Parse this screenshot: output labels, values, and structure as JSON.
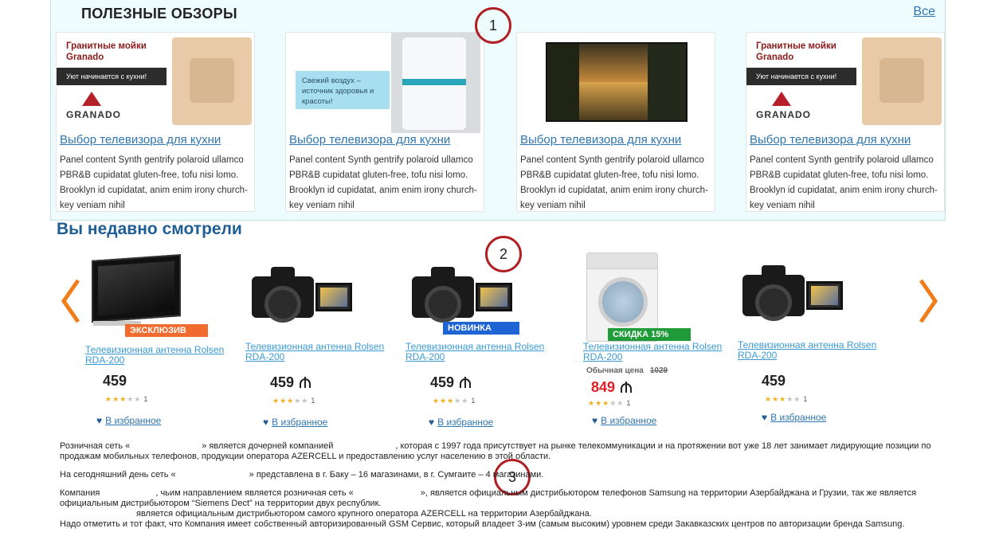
{
  "reviews": {
    "title": "ПОЛЕЗНЫЕ ОБЗОРЫ",
    "all_link": "Все",
    "cards": [
      {
        "title": "Выбор телевизора для кухни",
        "text": "Panel content Synth gentrify polaroid ullamco PBR&B cupidatat gluten-free, tofu nisi lomo. Brooklyn id cupidatat, anim enim irony church-key veniam nihil",
        "image": "granado",
        "brand_line1": "Гранитные мойки",
        "brand_line2": "Granado",
        "banner": "Уют начинается с кухни!",
        "logo": "GRANADO"
      },
      {
        "title": "Выбор телевизора для кухни",
        "text": "Panel content Synth gentrify polaroid ullamco PBR&B cupidatat gluten-free, tofu nisi lomo. Brooklyn id cupidatat, anim enim irony church-key veniam nihil",
        "image": "purifier",
        "promo": "Свежий воздух – источник здоровья и красоты!"
      },
      {
        "title": "Выбор телевизора для кухни",
        "text": "Panel content Synth gentrify polaroid ullamco PBR&B cupidatat gluten-free, tofu nisi lomo. Brooklyn id cupidatat, anim enim irony church-key veniam nihil",
        "image": "landscape-tv"
      },
      {
        "title": "Выбор телевизора для кухни",
        "text": "Panel content Synth gentrify polaroid ullamco PBR&B cupidatat gluten-free, tofu nisi lomo. Brooklyn id cupidatat, anim enim irony church-key veniam nihil",
        "image": "granado",
        "brand_line1": "Гранитные мойки",
        "brand_line2": "Granado",
        "banner": "Уют начинается с кухни!",
        "logo": "GRANADO"
      }
    ]
  },
  "recent": {
    "title": "Вы недавно смотрели",
    "prev_icon": "chevron-left-icon",
    "next_icon": "chevron-right-icon",
    "arrow_color": "#f07d1a",
    "fav_label": "В избранное",
    "products": [
      {
        "image": "tv",
        "badge": "ЭКСКЛЮЗИВ",
        "badge_color": "#f26b2e",
        "title": "Телевизионная антенна Rolsen RDA-200",
        "price": "459",
        "currency": false,
        "rating": 3,
        "reviews": "1"
      },
      {
        "image": "camera",
        "badge": "",
        "title": "Телевизионная антенна Rolsen RDA-200",
        "price": "459",
        "currency": true,
        "rating": 3,
        "reviews": "1"
      },
      {
        "image": "camera",
        "badge": "НОВИНКА",
        "badge_color": "#1f64d4",
        "title": "Телевизионная антенна Rolsen RDA-200",
        "price": "459",
        "currency": true,
        "rating": 3,
        "reviews": "1"
      },
      {
        "image": "washer",
        "badge": "СКИДКА 15%",
        "badge_color": "#1f9b3a",
        "title": "Телевизионная антенна Rolsen RDA-200",
        "old_price_label": "Обычная цена",
        "old_price": "1029",
        "price": "849",
        "currency": true,
        "rating": 3,
        "reviews": "1",
        "sale": true
      },
      {
        "image": "camera",
        "badge": "",
        "title": "Телевизионная антенна Rolsen RDA-200",
        "price": "459",
        "currency": false,
        "rating": 3,
        "reviews": "1"
      }
    ]
  },
  "annotations": [
    "1",
    "2",
    "3"
  ],
  "description": {
    "p1_a": "Розничная сеть «",
    "p1_b": "» является дочерней компанией",
    "p1_c": ", которая с 1997 года  присутствует на рынке телекоммуникации и  на протяжении вот уже 18 лет занимает лидирующие позиции по продажам мобильных телефонов, продукции оператора AZERCELL и предоставлению услуг населению в этой области.",
    "p2_a": "На сегодняшний день сеть «",
    "p2_b": "» представлена в г. Баку – 16 магазинами, в г. Сумгаите – 4 магазинами.",
    "p3_a": "Компания",
    "p3_b": ", чьим направлением является розничная сеть «",
    "p3_c": "», является официальным дистрибьютором телефонов Samsung на территории  Азербайджана и Грузии, так же является официальным дистрибьютором “Siemens Dect” на территории  двух республик.",
    "p4": "является официальным дистрибьютором самого крупного оператора AZERCELL на территории Азербайджана.",
    "p5": "Надо отметить и тот факт, что Компания имеет собственный авторизированный GSM Сервис, который владеет 3-им (самым высоким) уровнем среди  Закавказских центров по авторизации бренда Samsung."
  }
}
